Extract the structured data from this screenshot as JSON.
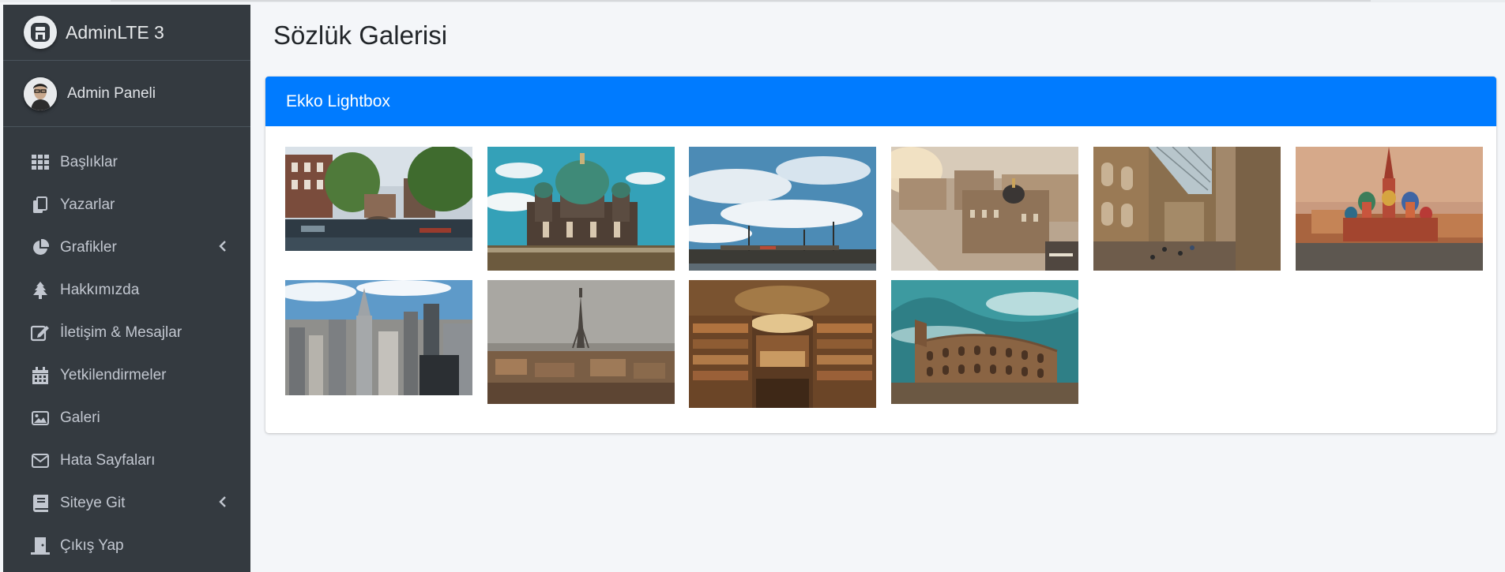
{
  "sidebar": {
    "brand": "AdminLTE 3",
    "user": "Admin Paneli",
    "items": [
      {
        "label": "Başlıklar",
        "icon": "th-grid-icon"
      },
      {
        "label": "Yazarlar",
        "icon": "copy-icon"
      },
      {
        "label": "Grafikler",
        "icon": "pie-chart-icon",
        "submenu": true
      },
      {
        "label": "Hakkımızda",
        "icon": "tree-icon"
      },
      {
        "label": "İletişim & Mesajlar",
        "icon": "edit-icon"
      },
      {
        "label": "Yetkilendirmeler",
        "icon": "calendar-icon"
      },
      {
        "label": "Galeri",
        "icon": "image-icon"
      },
      {
        "label": "Hata Sayfaları",
        "icon": "envelope-icon"
      },
      {
        "label": "Siteye Git",
        "icon": "book-icon",
        "submenu": true
      },
      {
        "label": "Çıkış Yap",
        "icon": "door-icon"
      }
    ]
  },
  "main": {
    "title": "Sözlük Galerisi",
    "card_title": "Ekko Lightbox"
  },
  "gallery": [
    {
      "name": "canal-city"
    },
    {
      "name": "cathedral-dome"
    },
    {
      "name": "blue-sky-harbor"
    },
    {
      "name": "city-rooftops"
    },
    {
      "name": "shopping-gallery"
    },
    {
      "name": "colorful-domes"
    },
    {
      "name": "skyline"
    },
    {
      "name": "tower-city"
    },
    {
      "name": "library"
    },
    {
      "name": "colosseum"
    }
  ],
  "colors": {
    "sidebar_bg": "#343a40",
    "primary": "#007bff",
    "content_bg": "#f4f6f9"
  }
}
